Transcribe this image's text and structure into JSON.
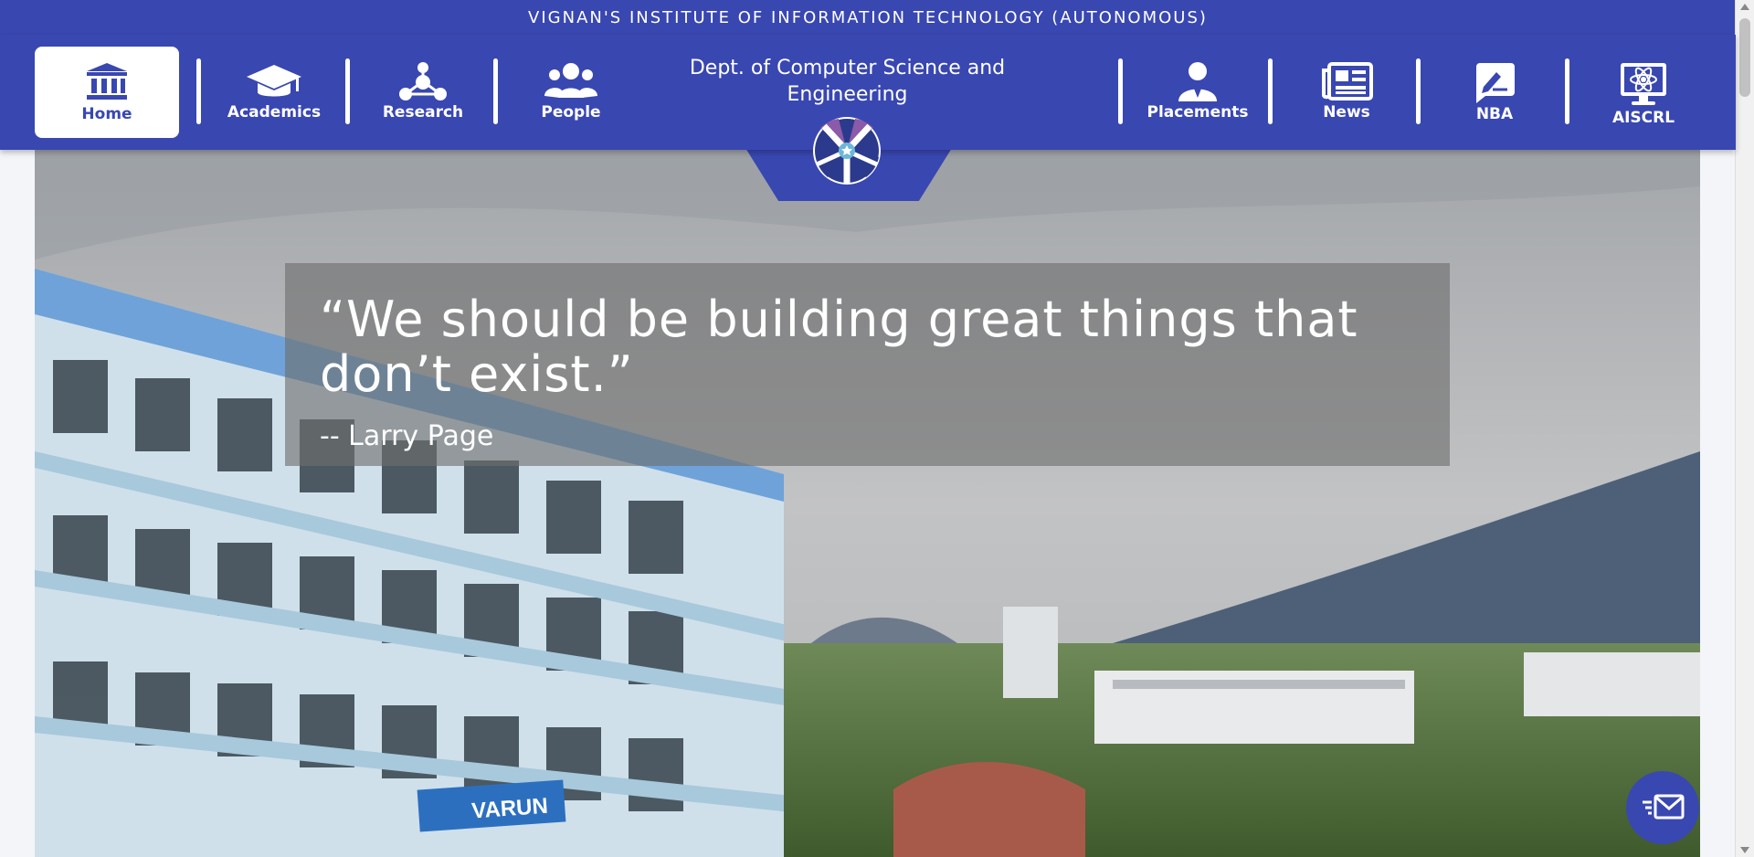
{
  "header": {
    "institute": "VIGNAN'S INSTITUTE OF INFORMATION TECHNOLOGY (AUTONOMOUS)",
    "department": "Dept. of Computer Science and Engineering"
  },
  "nav": {
    "home": {
      "label": "Home",
      "icon": "institution-icon"
    },
    "academics": {
      "label": "Academics",
      "icon": "graduation-cap-icon"
    },
    "research": {
      "label": "Research",
      "icon": "network-icon"
    },
    "people": {
      "label": "People",
      "icon": "users-icon"
    },
    "placements": {
      "label": "Placements",
      "icon": "user-tie-icon"
    },
    "news": {
      "label": "News",
      "icon": "newspaper-icon"
    },
    "nba": {
      "label": "NBA",
      "icon": "signature-icon"
    },
    "aiscrl": {
      "label": "AISCRL",
      "icon": "atom-monitor-icon"
    }
  },
  "hero": {
    "quote": "“We should be building great things that don’t exist.”",
    "author": "-- Larry Page",
    "building_sign": "VARUN"
  },
  "colors": {
    "primary": "#3947b1",
    "white": "#ffffff",
    "quote_overlay": "rgba(110,110,110,0.62)"
  },
  "fab": {
    "icon": "fast-mail-icon"
  }
}
